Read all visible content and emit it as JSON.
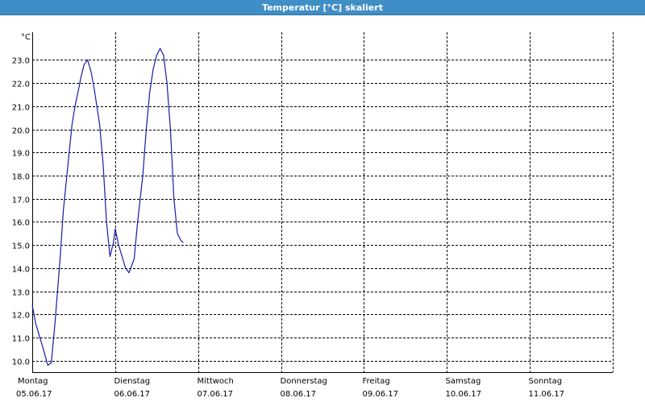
{
  "window": {
    "title": "Temperatur [°C] skaliert"
  },
  "colors": {
    "titlebar": "#3f8ec6",
    "line": "#1a1aa8",
    "grid": "#000000"
  },
  "chart_data": {
    "type": "line",
    "ylabel": "°C",
    "ylim": [
      9.5,
      24.2
    ],
    "xlim": [
      "2017-06-05T00:00",
      "2017-06-12T00:00"
    ],
    "grid": true,
    "yticks": [
      "10.0",
      "11.0",
      "12.0",
      "13.0",
      "14.0",
      "15.0",
      "16.0",
      "17.0",
      "18.0",
      "19.0",
      "20.0",
      "21.0",
      "22.0",
      "23.0"
    ],
    "xticks": [
      {
        "day": "Montag",
        "date": "05.06.17"
      },
      {
        "day": "Dienstag",
        "date": "06.06.17"
      },
      {
        "day": "Mittwoch",
        "date": "07.06.17"
      },
      {
        "day": "Donnerstag",
        "date": "08.06.17"
      },
      {
        "day": "Freitag",
        "date": "09.06.17"
      },
      {
        "day": "Samstag",
        "date": "10.06.17"
      },
      {
        "day": "Sonntag",
        "date": "11.06.17"
      }
    ],
    "series": [
      {
        "x": [
          "2017-06-05T00:00",
          "2017-06-05T01:00",
          "2017-06-05T03:00",
          "2017-06-05T04:30",
          "2017-06-05T05:30",
          "2017-06-05T06:30",
          "2017-06-05T08:00",
          "2017-06-05T09:00",
          "2017-06-05T10:00",
          "2017-06-05T11:30",
          "2017-06-05T12:30",
          "2017-06-05T13:30",
          "2017-06-05T14:00",
          "2017-06-05T15:00",
          "2017-06-05T16:00",
          "2017-06-05T17:00",
          "2017-06-05T18:00",
          "2017-06-05T19:30",
          "2017-06-05T20:30",
          "2017-06-05T21:30",
          "2017-06-05T22:30",
          "2017-06-05T23:30",
          "2017-06-06T00:00",
          "2017-06-06T01:00",
          "2017-06-06T02:00",
          "2017-06-06T03:00",
          "2017-06-06T04:00",
          "2017-06-06T05:30",
          "2017-06-06T06:30",
          "2017-06-06T08:00",
          "2017-06-06T09:00",
          "2017-06-06T10:00",
          "2017-06-06T11:00",
          "2017-06-06T12:00",
          "2017-06-06T13:00",
          "2017-06-06T14:00",
          "2017-06-06T15:00",
          "2017-06-06T16:00",
          "2017-06-06T17:00",
          "2017-06-06T18:00",
          "2017-06-06T19:00",
          "2017-06-06T19:45"
        ],
        "y": [
          12.4,
          11.6,
          10.6,
          9.8,
          9.9,
          11.5,
          14.3,
          16.5,
          18.0,
          20.2,
          21.1,
          21.8,
          22.2,
          22.8,
          23.0,
          22.5,
          21.7,
          20.2,
          18.5,
          16.0,
          14.5,
          15.1,
          15.7,
          15.0,
          14.5,
          14.0,
          13.8,
          14.4,
          16.0,
          18.0,
          20.0,
          21.6,
          22.6,
          23.2,
          23.5,
          23.2,
          22.0,
          20.0,
          17.0,
          15.5,
          15.2,
          15.1
        ]
      }
    ]
  }
}
